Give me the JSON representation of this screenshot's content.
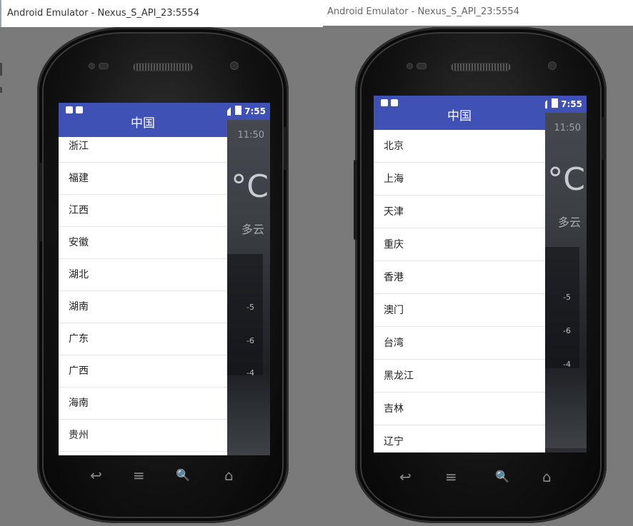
{
  "windows": [
    {
      "title": "Android Emulator - Nexus_S_API_23:5554",
      "status": {
        "time": "7:55"
      },
      "drawer": {
        "title": "中国",
        "items": [
          "浙江",
          "福建",
          "江西",
          "安徽",
          "湖北",
          "湖南",
          "广东",
          "广西",
          "海南",
          "贵州"
        ]
      },
      "weather": {
        "time": "11:50",
        "temp": "°C",
        "desc": "多云",
        "forecast": [
          "-5",
          "-6",
          "-4"
        ]
      }
    },
    {
      "title": "Android Emulator - Nexus_S_API_23:5554",
      "status": {
        "time": "7:55"
      },
      "drawer": {
        "title": "中国",
        "items": [
          "北京",
          "上海",
          "天津",
          "重庆",
          "香港",
          "澳门",
          "台湾",
          "黑龙江",
          "吉林",
          "辽宁"
        ]
      },
      "weather": {
        "time": "11:50",
        "temp": "°C",
        "desc": "多云",
        "forecast": [
          "-5",
          "-6",
          "-4"
        ]
      }
    }
  ],
  "icons": {
    "nav": [
      "back-icon",
      "menu-icon",
      "search-icon",
      "home-icon"
    ],
    "nav_glyphs": [
      "↩",
      "≡",
      "🔍",
      "⌂"
    ]
  },
  "colors": {
    "primary": "#3f51b5",
    "background": "#7a7a7a"
  }
}
